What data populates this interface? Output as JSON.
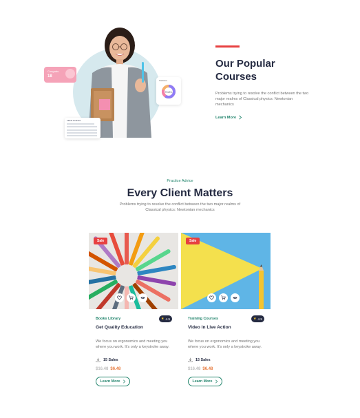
{
  "hero": {
    "stat_card": {
      "label": "Congrats",
      "value": "18"
    },
    "chart_card": {
      "title": "Statistics",
      "center_label": "Graphic"
    },
    "table_card": {
      "title": "Latest Courses"
    },
    "title": "Our Popular Courses",
    "text": "Problems trying to resolve the conflict between the two major realms of Classical physics: Newtonian mechanics",
    "link_label": "Learn More",
    "accent_color": "#e74040"
  },
  "section": {
    "eyebrow": "Practice Advice",
    "title": "Every Client Matters",
    "text": "Problems trying to resolve the conflict between the two major realms of Classical physics: Newtonian mechanics"
  },
  "cards": [
    {
      "badge": "Sale",
      "category": "Books Library",
      "rating": "4.9",
      "title": "Get Quality Education",
      "description": "We focus on ergonomics and meeting you where you work. It's only a keystroke away.",
      "sales": "15 Sales",
      "old_price": "$16.48",
      "new_price": "$6.48",
      "button": "Learn More"
    },
    {
      "badge": "Sale",
      "category": "Training Courses",
      "rating": "4.9",
      "title": "Video In Live Action",
      "description": "We focus on ergonomics and meeting you where you work. It's only a keystroke away.",
      "sales": "15 Sales",
      "old_price": "$16.48",
      "new_price": "$6.48",
      "button": "Learn More"
    }
  ],
  "colors": {
    "primary": "#23856d",
    "dark": "#252b42",
    "muted": "#737373",
    "sale": "#e74040",
    "price": "#e77c40"
  }
}
